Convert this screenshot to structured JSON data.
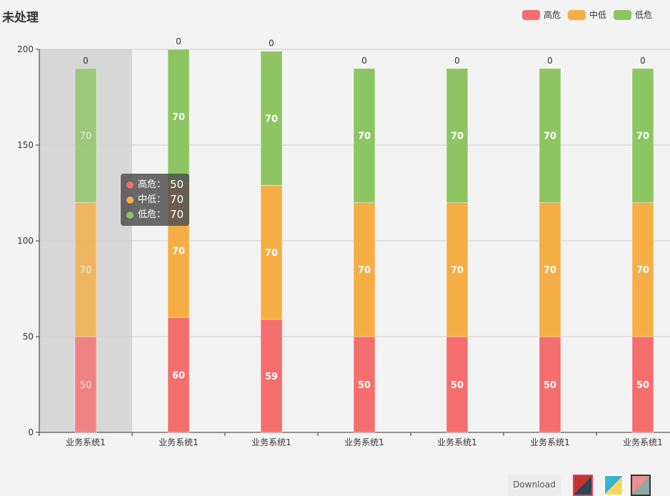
{
  "title": "未处理",
  "legend": [
    {
      "name": "高危",
      "color": "#f56e6e"
    },
    {
      "name": "中低",
      "color": "#f5ae45"
    },
    {
      "name": "低危",
      "color": "#8dc563"
    }
  ],
  "tooltip": {
    "rows": [
      {
        "label": "高危：",
        "value": "50",
        "color": "#f56e6e"
      },
      {
        "label": "中低：",
        "value": "70",
        "color": "#f5ae45"
      },
      {
        "label": "低危：",
        "value": "70",
        "color": "#8dc563"
      }
    ]
  },
  "toolbar": {
    "download_label": "Download",
    "themes": [
      "theme-red-dark",
      "theme-blue-yellow",
      "theme-pink-gray"
    ]
  },
  "chart_data": {
    "type": "bar",
    "stacked": true,
    "title": "未处理",
    "categories": [
      "业务系统1",
      "业务系统1",
      "业务系统1",
      "业务系统1",
      "业务系统1",
      "业务系统1",
      "业务系统1"
    ],
    "series": [
      {
        "name": "高危",
        "values": [
          50,
          60,
          59,
          50,
          50,
          50,
          50
        ]
      },
      {
        "name": "中低",
        "values": [
          70,
          70,
          70,
          70,
          70,
          70,
          70
        ]
      },
      {
        "name": "低危",
        "values": [
          70,
          70,
          70,
          70,
          70,
          70,
          70
        ]
      }
    ],
    "top_labels": [
      "0",
      "0",
      "0",
      "0",
      "0",
      "0",
      "0"
    ],
    "yticks": [
      0,
      50,
      100,
      150,
      200
    ],
    "ylim": [
      0,
      200
    ],
    "xlabel": "",
    "ylabel": "",
    "grid": true,
    "legend_position": "top-right",
    "highlighted_category_index": 0
  }
}
